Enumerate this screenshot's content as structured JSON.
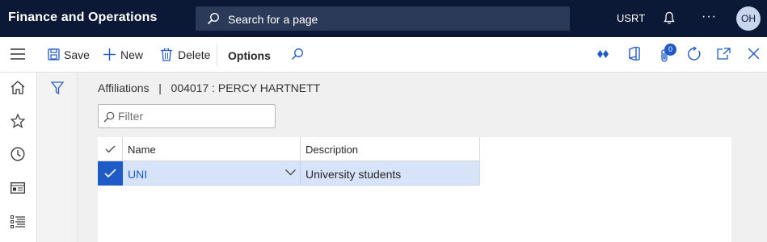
{
  "app": {
    "title": "Finance and Operations"
  },
  "topbar": {
    "search_label": "Search for a page",
    "company": "USRT",
    "more_label": "···",
    "avatar_initials": "OH"
  },
  "actions": {
    "save_label": "Save",
    "new_label": "New",
    "delete_label": "Delete",
    "options_label": "Options",
    "attachments_count": "0"
  },
  "breadcrumb": "Affiliations   |   004017 : PERCY HARTNETT",
  "filter": {
    "placeholder": "Filter"
  },
  "grid": {
    "columns": [
      "Name",
      "Description"
    ],
    "rows": [
      {
        "name": "UNI",
        "description": "University students",
        "selected": true
      }
    ]
  },
  "colors": {
    "topbar": "#0b1936",
    "accent": "#1e5bc6",
    "selected_row": "#d6e3f8"
  }
}
